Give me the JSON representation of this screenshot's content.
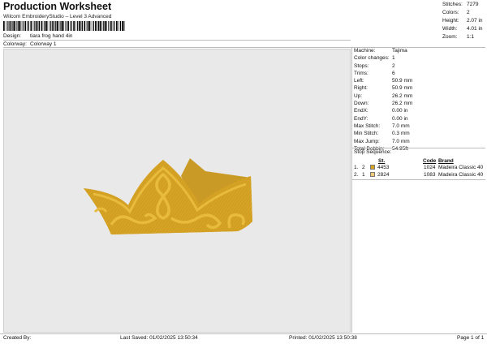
{
  "header": {
    "title": "Production Worksheet",
    "subtitle": "Wilcom EmbroideryStudio – Level 3 Advanced"
  },
  "design_info": {
    "design_label": "Design:",
    "design_value": "tiara frog hand 4in",
    "colorway_label": "Colorway:",
    "colorway_value": "Colorway 1"
  },
  "stats": [
    {
      "label": "Stitches:",
      "value": "7279"
    },
    {
      "label": "Colors:",
      "value": "2"
    },
    {
      "label": "Height:",
      "value": "2.07 in"
    },
    {
      "label": "Width:",
      "value": "4.01 in"
    },
    {
      "label": "Zoom:",
      "value": "1:1"
    }
  ],
  "machine_info": [
    {
      "label": "Machine:",
      "value": "Tajima"
    },
    {
      "label": "Color changes:",
      "value": "1"
    },
    {
      "label": "Stops:",
      "value": "2"
    },
    {
      "label": "Trims:",
      "value": "6"
    },
    {
      "label": "Left:",
      "value": "50.9 mm"
    },
    {
      "label": "Right:",
      "value": "50.9 mm"
    },
    {
      "label": "Up:",
      "value": "26.2 mm"
    },
    {
      "label": "Down:",
      "value": "26.2 mm"
    },
    {
      "label": "EndX:",
      "value": "0.00 in"
    },
    {
      "label": "EndY:",
      "value": "0.00 in"
    },
    {
      "label": "Max Stitch:",
      "value": "7.0 mm"
    },
    {
      "label": "Min Stitch:",
      "value": "0.3 mm"
    },
    {
      "label": "Max Jump:",
      "value": "7.0 mm"
    },
    {
      "label": "Total Bobbin:",
      "value": "54.95ft"
    }
  ],
  "stop_sequence": {
    "title": "Stop Sequence:",
    "headers": {
      "st": "St.",
      "code": "Code",
      "brand": "Brand"
    },
    "rows": [
      {
        "stop": "1.",
        "index": "2",
        "color": "#d9a521",
        "st": "4453",
        "code": "1024",
        "brand": "Madeira Classic 40"
      },
      {
        "stop": "2.",
        "index": "1",
        "color": "#f2c978",
        "st": "2824",
        "code": "1083",
        "brand": "Madeira Classic 40"
      }
    ]
  },
  "colors": {
    "crown_main": "#d6a324",
    "crown_light": "#e8bb3c",
    "crown_dark": "#b9861a",
    "crown_back": "#c99a25"
  },
  "footer": {
    "created_by": "Created By:",
    "last_saved": "Last Saved: 01/02/2025 13:50:34",
    "printed": "Printed: 01/02/2025 13:50:38",
    "page": "Page 1 of 1"
  }
}
